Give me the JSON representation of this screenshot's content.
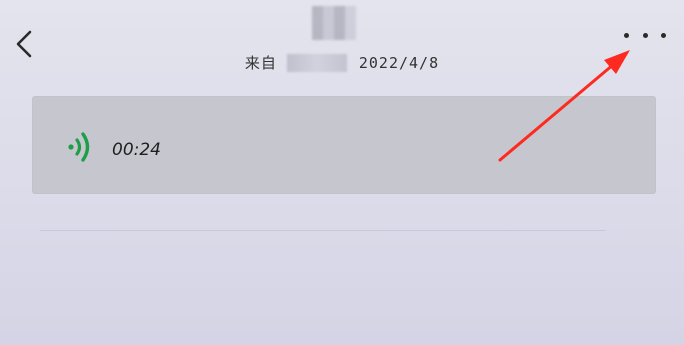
{
  "header": {
    "back_icon": "chevron-left-icon",
    "more_icon": "more-horizontal-icon"
  },
  "subtitle": {
    "from_label": "来自",
    "date": "2022/4/8"
  },
  "message": {
    "voice_icon": "voice-wave-icon",
    "duration": "00:24",
    "accent_color": "#1f9e4a"
  },
  "annotation": {
    "arrow_color": "#ff2a1f"
  }
}
